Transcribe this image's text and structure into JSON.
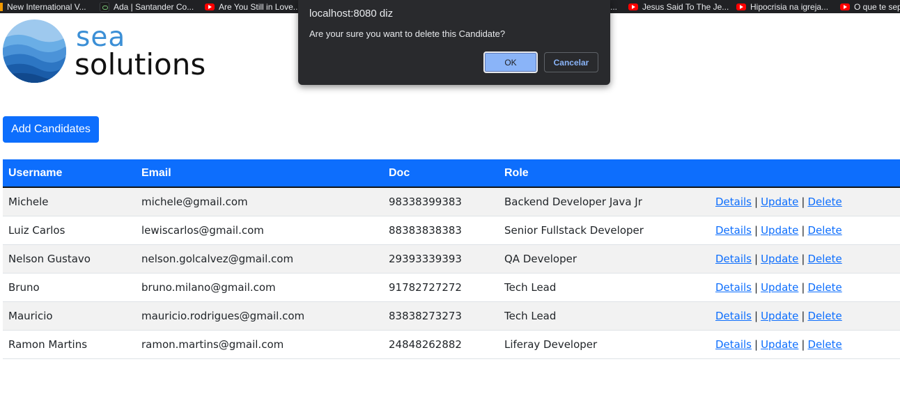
{
  "bookmarks": [
    {
      "label": "New International V...",
      "icon": "orange-bar-icon"
    },
    {
      "label": "Ada | Santander Co...",
      "icon": "ada-icon"
    },
    {
      "label": "Are You Still in Love...",
      "icon": "youtube-icon"
    },
    {
      "label": "...",
      "icon": ""
    },
    {
      "label": "Jesus Said To The Je...",
      "icon": "youtube-icon"
    },
    {
      "label": "Hipocrisia na igreja...",
      "icon": "youtube-icon"
    },
    {
      "label": "O que te sep",
      "icon": "youtube-icon"
    }
  ],
  "logo": {
    "line1": "sea",
    "line2": "solutions"
  },
  "add_button_label": "Add Candidates",
  "table": {
    "headers": [
      "Username",
      "Email",
      "Doc",
      "Role",
      ""
    ],
    "rows": [
      {
        "username": "Michele",
        "email": "michele@gmail.com",
        "doc": "98338399383",
        "role": "Backend Developer Java Jr"
      },
      {
        "username": "Luiz Carlos",
        "email": "lewiscarlos@gmail.com",
        "doc": "88383838383",
        "role": "Senior Fullstack Developer"
      },
      {
        "username": "Nelson Gustavo",
        "email": "nelson.golcalvez@gmail.com",
        "doc": "29393339393",
        "role": "QA Developer"
      },
      {
        "username": "Bruno",
        "email": "bruno.milano@gmail.com",
        "doc": "91782727272",
        "role": "Tech Lead"
      },
      {
        "username": "Mauricio",
        "email": "mauricio.rodrigues@gmail.com",
        "doc": "83838273273",
        "role": "Tech Lead"
      },
      {
        "username": "Ramon Martins",
        "email": "ramon.martins@gmail.com",
        "doc": "24848262882",
        "role": "Liferay Developer"
      }
    ],
    "actions": {
      "details": "Details",
      "update": "Update",
      "delete": "Delete",
      "separator": "|"
    }
  },
  "dialog": {
    "title": "localhost:8080 diz",
    "message": "Are your sure you want to delete this Candidate?",
    "ok_label": "OK",
    "cancel_label": "Cancelar"
  },
  "colors": {
    "primary": "#0d6efd",
    "logo_blue": "#3b8fd6",
    "dialog_bg": "#292a2d",
    "dialog_accent": "#8ab4f8",
    "bookmark_bar": "#202124"
  }
}
